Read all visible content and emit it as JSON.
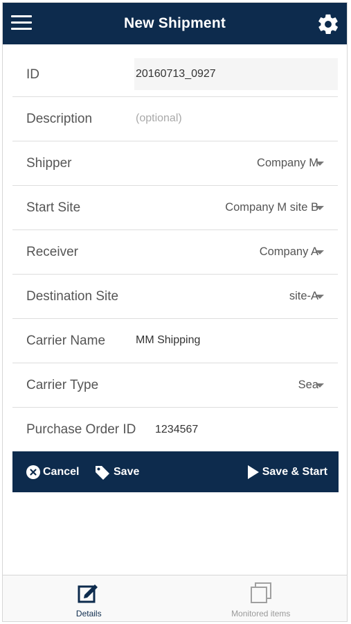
{
  "header": {
    "title": "New Shipment",
    "menu_icon": "hamburger-menu-icon",
    "settings_icon": "gear-icon"
  },
  "form": {
    "id": {
      "label": "ID",
      "value": "20160713_0927"
    },
    "description": {
      "label": "Description",
      "placeholder": "(optional)"
    },
    "shipper": {
      "label": "Shipper",
      "value": "Company M"
    },
    "start_site": {
      "label": "Start Site",
      "value": "Company M site B"
    },
    "receiver": {
      "label": "Receiver",
      "value": "Company A"
    },
    "destination_site": {
      "label": "Destination Site",
      "value": "site-A"
    },
    "carrier_name": {
      "label": "Carrier Name",
      "value": "MM Shipping"
    },
    "carrier_type": {
      "label": "Carrier Type",
      "value": "Sea"
    },
    "purchase_order": {
      "label": "Purchase Order ID",
      "value": "1234567"
    }
  },
  "actions": {
    "cancel": "Cancel",
    "save": "Save",
    "save_start": "Save & Start"
  },
  "tabs": [
    {
      "label": "Details",
      "icon": "edit-icon",
      "active": true
    },
    {
      "label": "Monitored items",
      "icon": "copy-icon",
      "active": false
    }
  ],
  "colors": {
    "brand": "#0d2b4d",
    "active_tab": "#0d2b4d",
    "inactive_tab": "#9a9a9a"
  }
}
